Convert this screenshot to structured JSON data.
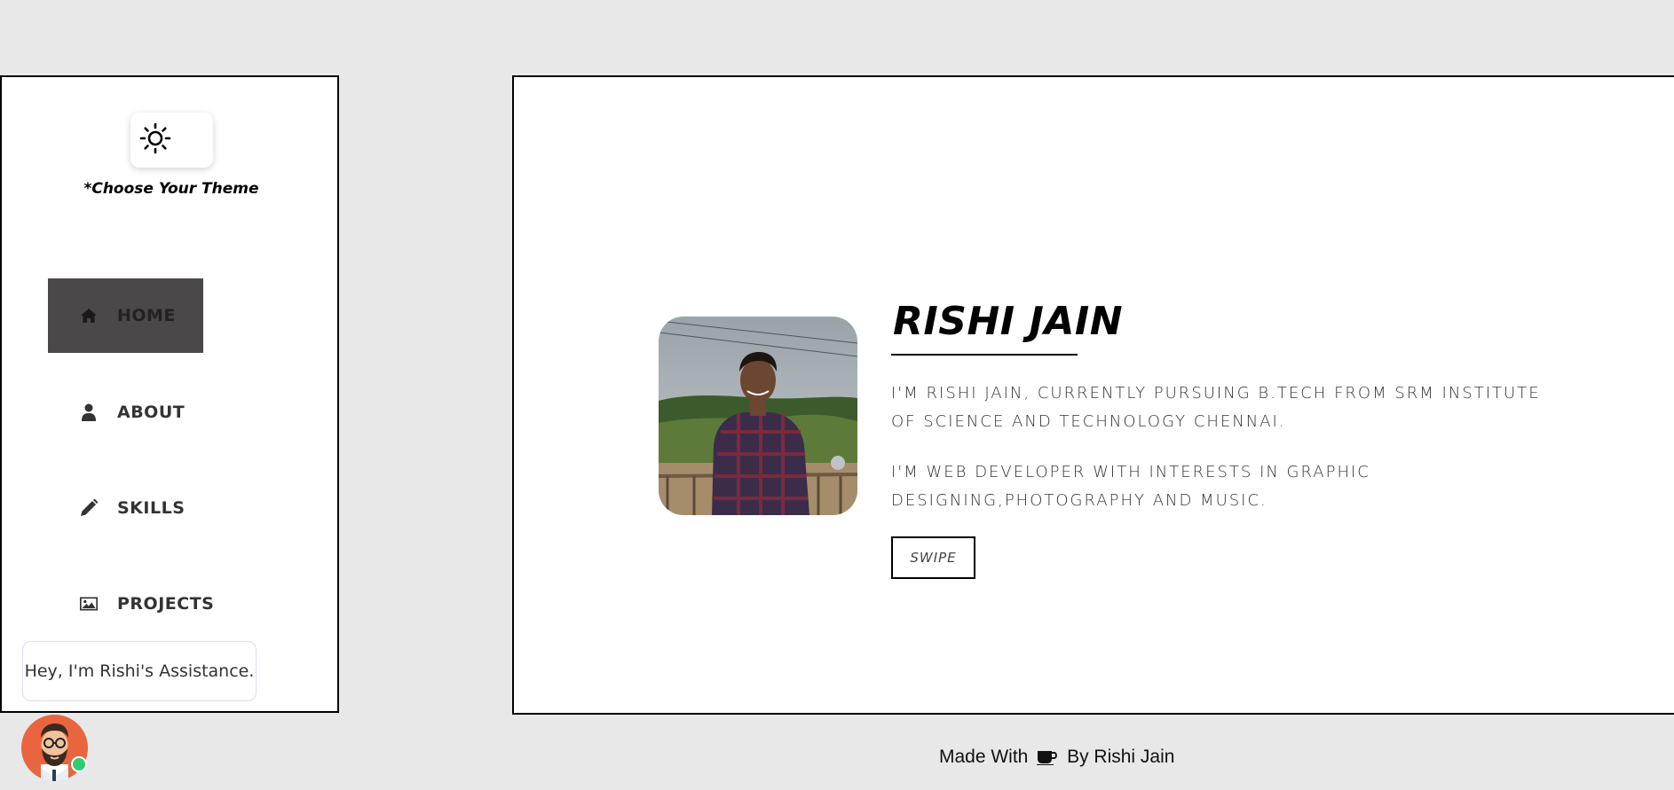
{
  "sidebar": {
    "theme_toggle": {
      "icon": "sun-icon"
    },
    "theme_hint": "*Choose Your Theme",
    "nav": [
      {
        "label": "HOME",
        "icon": "home-icon",
        "active": true
      },
      {
        "label": "ABOUT",
        "icon": "user-icon",
        "active": false
      },
      {
        "label": "SKILLS",
        "icon": "pencil-icon",
        "active": false
      },
      {
        "label": "PROJECTS",
        "icon": "image-icon",
        "active": false
      }
    ]
  },
  "chat": {
    "message": "Hey, I'm Rishi's Assistance.",
    "avatar_icon": "bearded-man-avatar",
    "status": "online"
  },
  "hero": {
    "name": "RISHI JAIN",
    "paragraph_1": "I'M RISHI JAIN, CURRENTLY PURSUING B.TECH FROM SRM INSTITUTE OF SCIENCE AND TECHNOLOGY CHENNAI.",
    "paragraph_2": "I'M WEB DEVELOPER WITH INTERESTS IN GRAPHIC DESIGNING,PHOTOGRAPHY AND MUSIC.",
    "swipe_label": "SWIPE"
  },
  "footer": {
    "prefix": "Made With",
    "icon": "coffee-icon",
    "suffix": "By Rishi Jain"
  },
  "colors": {
    "page_bg": "#e8e8e8",
    "active_nav_bg": "#4a4849",
    "avatar_bg": "#e8653f",
    "online": "#2ecc71"
  }
}
